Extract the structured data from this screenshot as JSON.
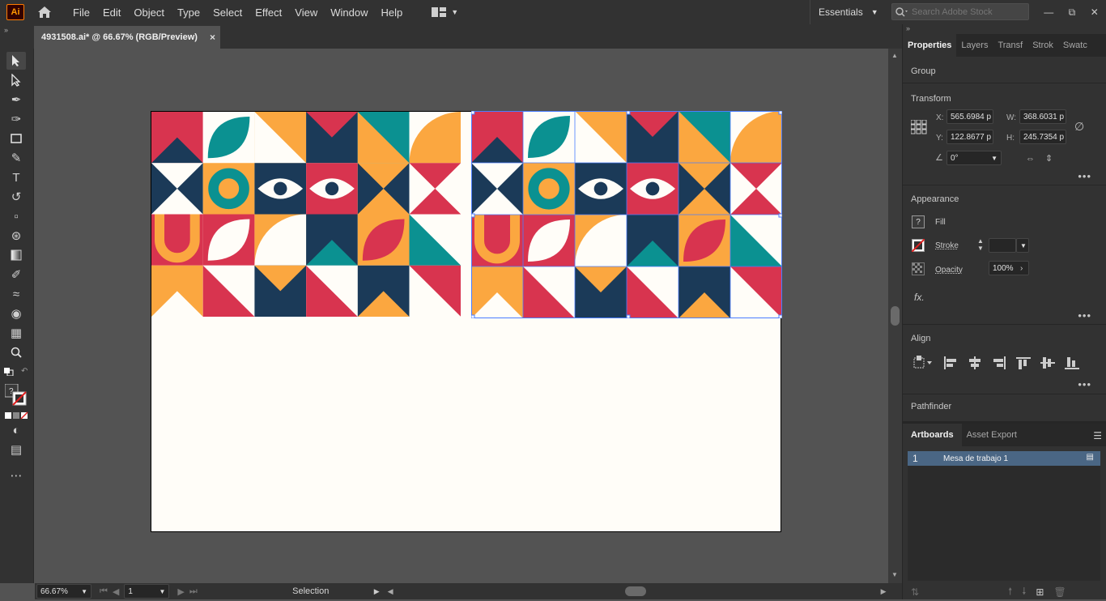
{
  "app": {
    "logo": "Ai"
  },
  "menu": [
    "File",
    "Edit",
    "Object",
    "Type",
    "Select",
    "Effect",
    "View",
    "Window",
    "Help"
  ],
  "workspace": {
    "label": "Essentials"
  },
  "search": {
    "placeholder": "Search Adobe Stock"
  },
  "document": {
    "tab_title": "4931508.ai* @ 66.67% (RGB/Preview)",
    "close": "×"
  },
  "status": {
    "zoom": "66.67%",
    "artboard_nav": "1",
    "tool": "Selection"
  },
  "panel": {
    "tabs": [
      "Properties",
      "Layers",
      "Transf",
      "Strok",
      "Swatc"
    ],
    "group_label": "Group",
    "transform": {
      "title": "Transform",
      "x_label": "X:",
      "x": "565.6984 p",
      "w_label": "W:",
      "w": "368.6031 p",
      "y_label": "Y:",
      "y": "122.8677 p",
      "h_label": "H:",
      "h": "245.7354 p",
      "angle": "0°"
    },
    "appearance": {
      "title": "Appearance",
      "fill": "Fill",
      "stroke": "Stroke",
      "opacity_label": "Opacity",
      "opacity": "100%",
      "fx": "fx."
    },
    "align": {
      "title": "Align"
    },
    "pathfinder": {
      "title": "Pathfinder"
    },
    "artboards": {
      "tab1": "Artboards",
      "tab2": "Asset Export",
      "row_num": "1",
      "row_name": "Mesa de trabajo 1"
    }
  },
  "colors": {
    "navy": "#1b3a58",
    "teal": "#0b9191",
    "orange": "#fba740",
    "red": "#d8344f",
    "white": "#fffdf8",
    "selection": "#4a7dff"
  }
}
